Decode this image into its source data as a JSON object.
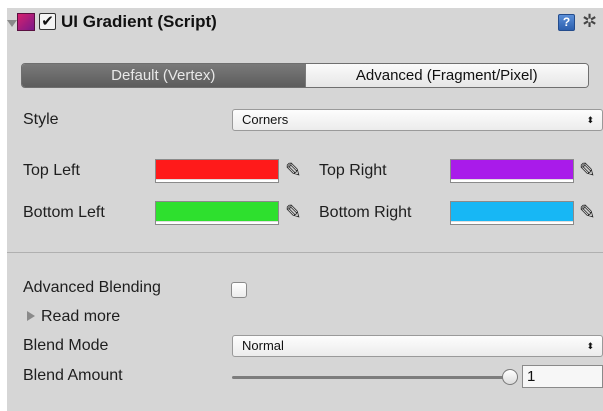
{
  "header": {
    "title": "UI Gradient (Script)",
    "enabled_check": "✔",
    "help_icon_glyph": "?",
    "gear_icon_glyph": "✲"
  },
  "tabs": [
    {
      "label": "Default (Vertex)",
      "active": true
    },
    {
      "label": "Advanced (Fragment/Pixel)",
      "active": false
    }
  ],
  "style": {
    "label": "Style",
    "value": "Corners",
    "arrows": "⬍"
  },
  "colors": {
    "top_left": {
      "label": "Top Left",
      "color": "#ff1a1a"
    },
    "top_right": {
      "label": "Top Right",
      "color": "#a91bea"
    },
    "bottom_left": {
      "label": "Bottom Left",
      "color": "#2ee02e"
    },
    "bottom_right": {
      "label": "Bottom Right",
      "color": "#17b7f5"
    }
  },
  "picker_glyph": "✎",
  "advanced_blending": {
    "label": "Advanced Blending",
    "checked": false
  },
  "read_more": {
    "label": "Read more"
  },
  "blend_mode": {
    "label": "Blend Mode",
    "value": "Normal",
    "arrows": "⬍"
  },
  "blend_amount": {
    "label": "Blend Amount",
    "value": "1",
    "fraction": 1
  }
}
